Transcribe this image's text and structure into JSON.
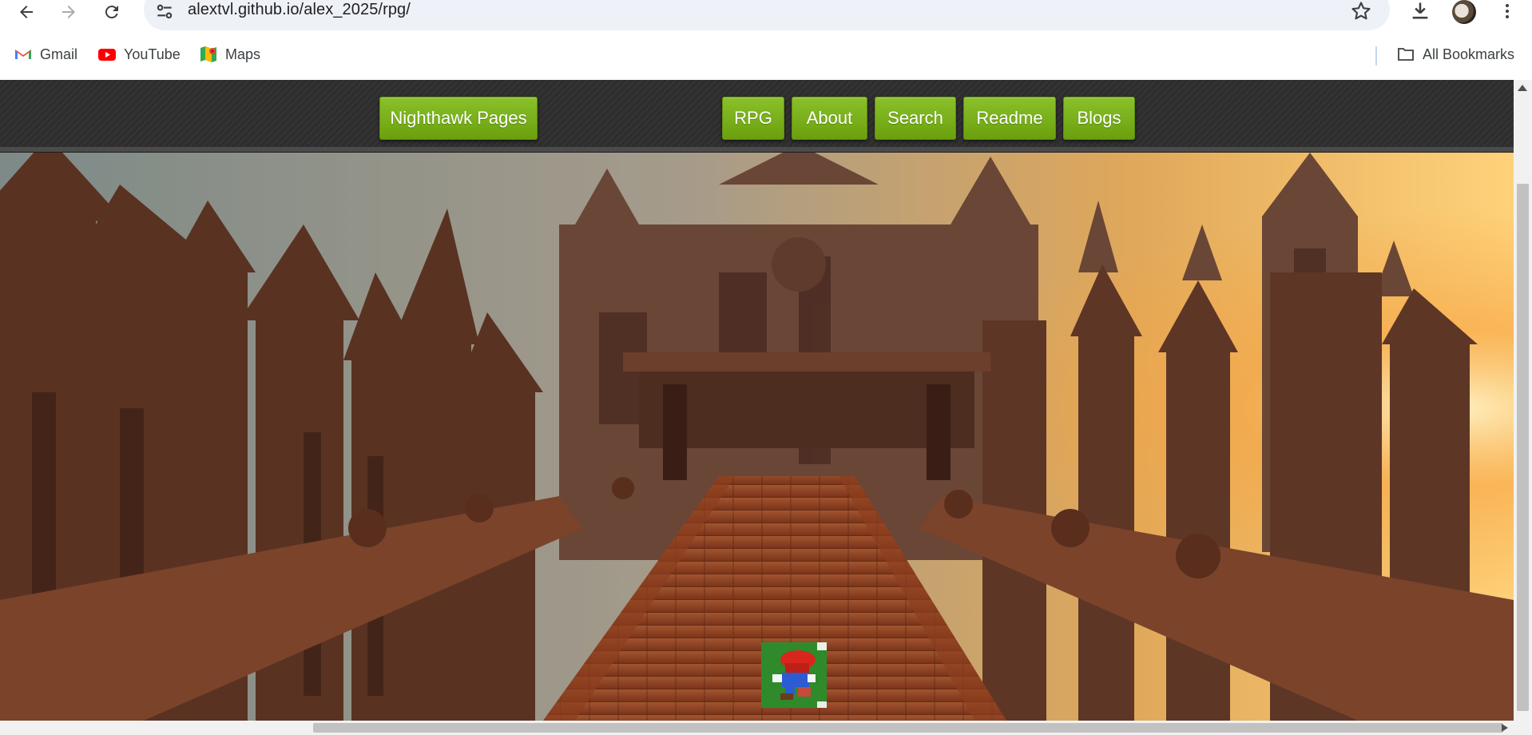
{
  "browser": {
    "url": "alextvl.github.io/alex_2025/rpg/",
    "bookmarks": [
      {
        "label": "Gmail",
        "icon": "gmail-icon"
      },
      {
        "label": "YouTube",
        "icon": "youtube-icon"
      },
      {
        "label": "Maps",
        "icon": "maps-icon"
      }
    ],
    "all_bookmarks_label": "All Bookmarks"
  },
  "site": {
    "brand_label": "Nighthawk Pages",
    "nav": [
      {
        "label": "RPG"
      },
      {
        "label": "About"
      },
      {
        "label": "Search"
      },
      {
        "label": "Readme"
      },
      {
        "label": "Blogs"
      }
    ],
    "accent_color": "#7cb518"
  },
  "game": {
    "background_scene": "gothic castle bridge at sunset",
    "player": "pixel-art character sprite (red cap) on green tile"
  }
}
